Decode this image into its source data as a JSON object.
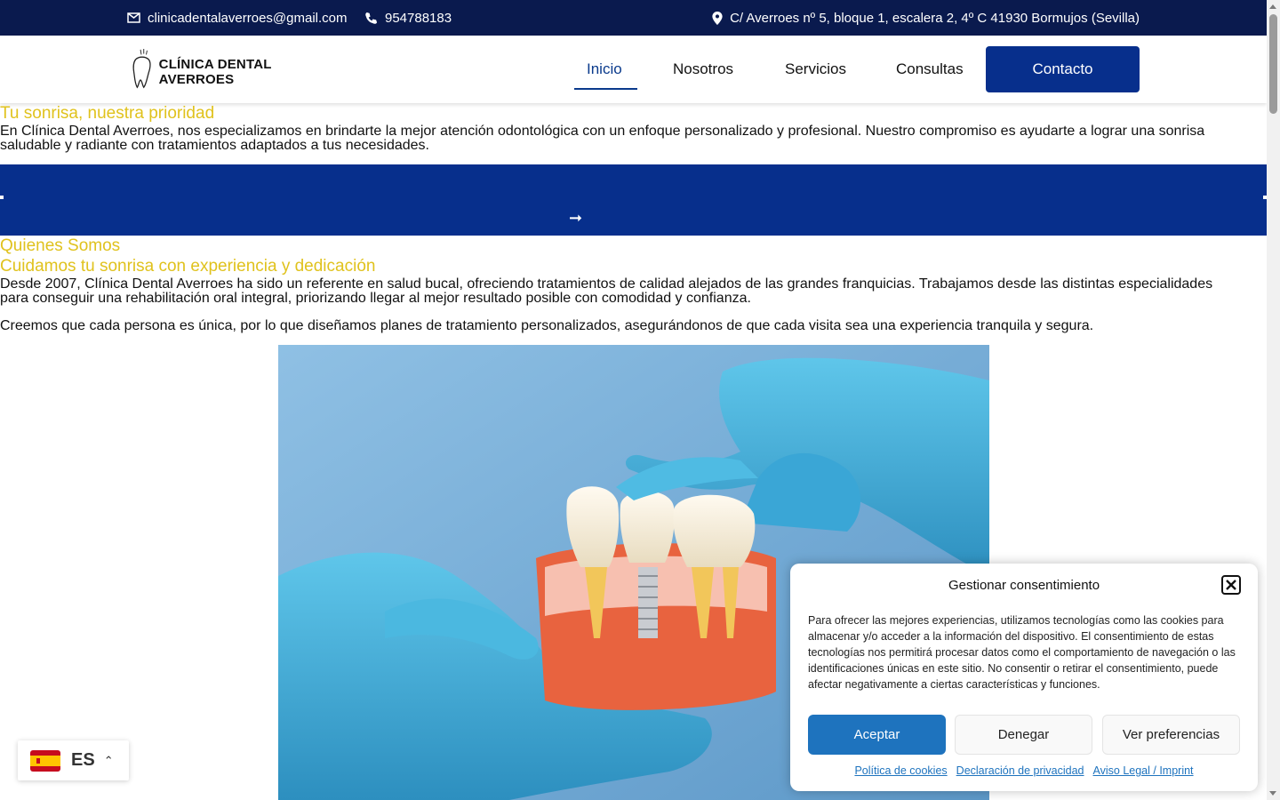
{
  "topbar": {
    "email": "clinicadentalaverroes@gmail.com",
    "phone": "954788183",
    "address": "C/ Averroes nº 5, bloque 1, escalera 2, 4º C 41930 Bormujos (Sevilla)"
  },
  "header": {
    "logo_text": "CLÍNICA DENTAL AVERROES",
    "nav": [
      "Inicio",
      "Nosotros",
      "Servicios",
      "Consultas"
    ],
    "active_nav": "Inicio",
    "contact_label": "Contacto"
  },
  "hero": {
    "title": "Tu sonrisa, nuestra prioridad",
    "text": "En Clínica Dental Averroes, nos especializamos en brindarte la mejor atención odontológica con un enfoque personalizado y profesional. Nuestro compromiso es ayudarte a lograr una sonrisa saludable y radiante con tratamientos adaptados a tus necesidades."
  },
  "about": {
    "tag": "Quienes Somos",
    "heading": "Cuidamos tu sonrisa con experiencia y dedicación",
    "text1": "Desde 2007, Clínica Dental Averroes ha sido un referente en salud bucal, ofreciendo tratamientos de calidad alejados de las grandes franquicias.  Trabajamos desde las distintas especialidades para conseguir una rehabilitación oral integral, priorizando llegar al mejor resultado posible con comodidad y confianza.",
    "text2": "Creemos que cada persona es única, por lo que diseñamos planes de tratamiento personalizados, asegurándonos de que cada visita sea una experiencia tranquila y segura."
  },
  "language": {
    "code": "ES"
  },
  "cookie": {
    "title": "Gestionar consentimiento",
    "body": "Para ofrecer las mejores experiencias, utilizamos tecnologías como las cookies para almacenar y/o acceder a la información del dispositivo. El consentimiento de estas tecnologías nos permitirá procesar datos como el comportamiento de navegación o las identificaciones únicas en este sitio. No consentir o retirar el consentimiento, puede afectar negativamente a ciertas características y funciones.",
    "accept": "Aceptar",
    "deny": "Denegar",
    "preferences": "Ver preferencias",
    "links": [
      "Política de cookies",
      "Declaración de privacidad",
      "Aviso Legal / Imprint"
    ]
  },
  "colors": {
    "topbar": "#0a1a4e",
    "primary": "#072f8c",
    "accent_yellow": "#e0c21d",
    "accept_button": "#1e73be"
  }
}
